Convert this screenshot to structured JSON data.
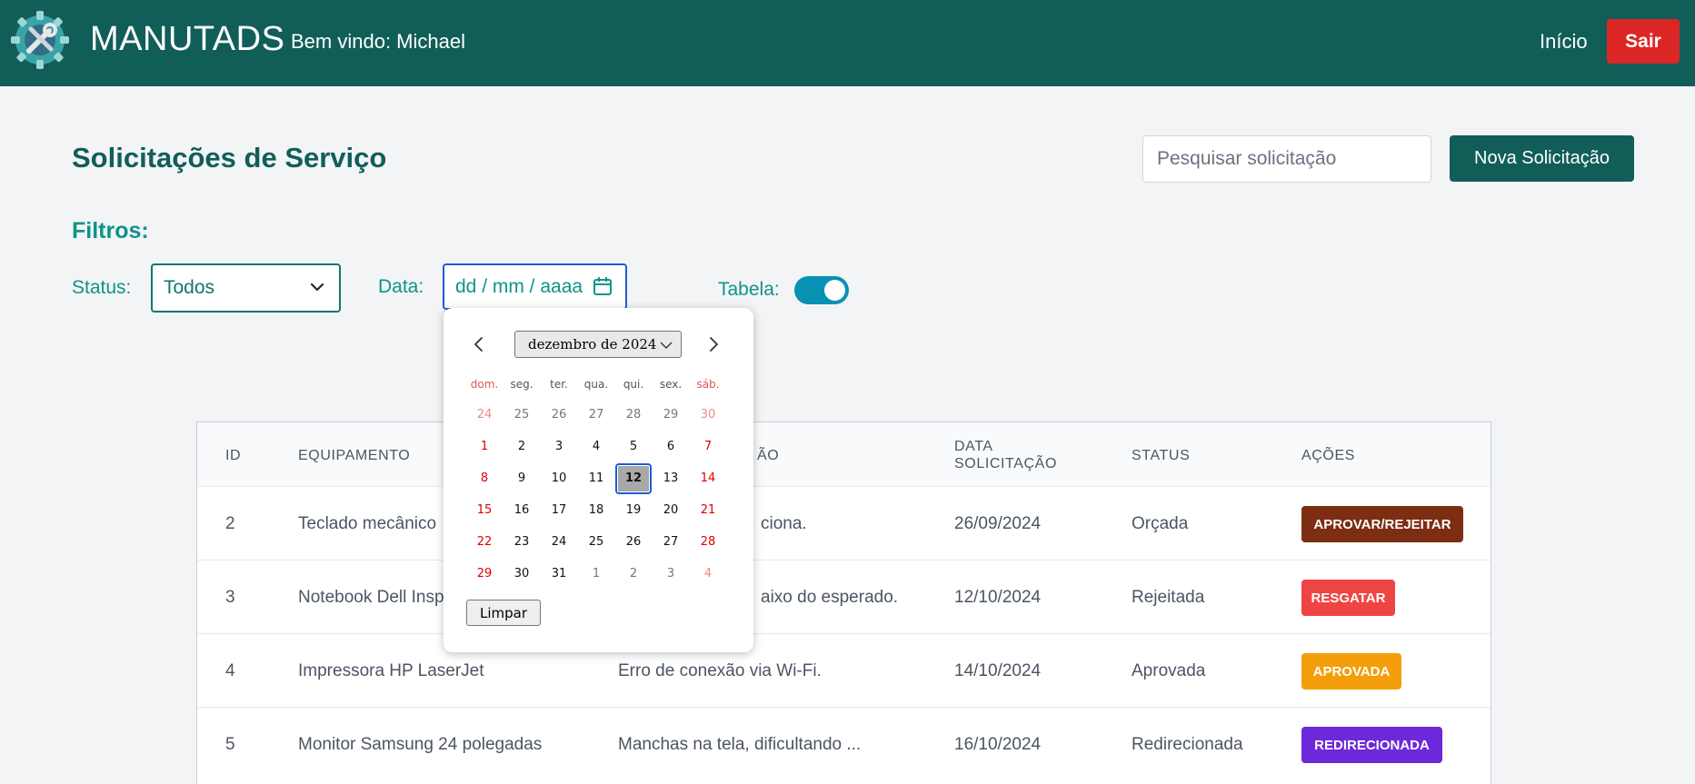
{
  "header": {
    "brand": "MANUTADS",
    "welcome": "Bem vindo: Michael",
    "nav_home": "Início",
    "logout": "Sair",
    "colors": {
      "bar": "#115e59",
      "logout": "#dc2626"
    }
  },
  "page": {
    "title": "Solicitações de Serviço",
    "search_placeholder": "Pesquisar solicitação",
    "new_button": "Nova Solicitação"
  },
  "filters": {
    "title": "Filtros:",
    "status_label": "Status:",
    "status_value": "Todos",
    "date_label": "Data:",
    "date_placeholder": "dd / mm / aaaa",
    "table_label": "Tabela:",
    "table_toggle_on": true
  },
  "calendar": {
    "month": "dezembro de 2024",
    "weekdays": [
      "dom.",
      "seg.",
      "ter.",
      "qua.",
      "qui.",
      "sex.",
      "sáb."
    ],
    "weeks": [
      [
        "24",
        "25",
        "26",
        "27",
        "28",
        "29",
        "30"
      ],
      [
        "1",
        "2",
        "3",
        "4",
        "5",
        "6",
        "7"
      ],
      [
        "8",
        "9",
        "10",
        "11",
        "12",
        "13",
        "14"
      ],
      [
        "15",
        "16",
        "17",
        "18",
        "19",
        "20",
        "21"
      ],
      [
        "22",
        "23",
        "24",
        "25",
        "26",
        "27",
        "28"
      ],
      [
        "29",
        "30",
        "31",
        "1",
        "2",
        "3",
        "4"
      ]
    ],
    "selected_day": "12",
    "clear": "Limpar"
  },
  "table": {
    "headers": {
      "id": "ID",
      "equipment": "EQUIPAMENTO",
      "description": "ÃO",
      "date_line1": "DATA",
      "date_line2": "SOLICITAÇÃO",
      "status": "STATUS",
      "actions": "AÇÕES"
    },
    "rows": [
      {
        "id": "2",
        "equipment": "Teclado mecânico",
        "description": "ciona.",
        "date": "26/09/2024",
        "status": "Orçada",
        "action": "APROVAR/REJEITAR",
        "action_color": "#7c2d12"
      },
      {
        "id": "3",
        "equipment": "Notebook Dell Insp",
        "description": "aixo do esperado.",
        "date": "12/10/2024",
        "status": "Rejeitada",
        "action": "RESGATAR",
        "action_color": "#ef4444"
      },
      {
        "id": "4",
        "equipment": "Impressora HP LaserJet",
        "description": "Erro de conexão via Wi-Fi.",
        "date": "14/10/2024",
        "status": "Aprovada",
        "action": "APROVADA",
        "action_color": "#f59e0b"
      },
      {
        "id": "5",
        "equipment": "Monitor Samsung 24 polegadas",
        "description": "Manchas na tela, dificultando ...",
        "date": "16/10/2024",
        "status": "Redirecionada",
        "action": "REDIRECIONADA",
        "action_color": "#6d28d9"
      }
    ]
  }
}
